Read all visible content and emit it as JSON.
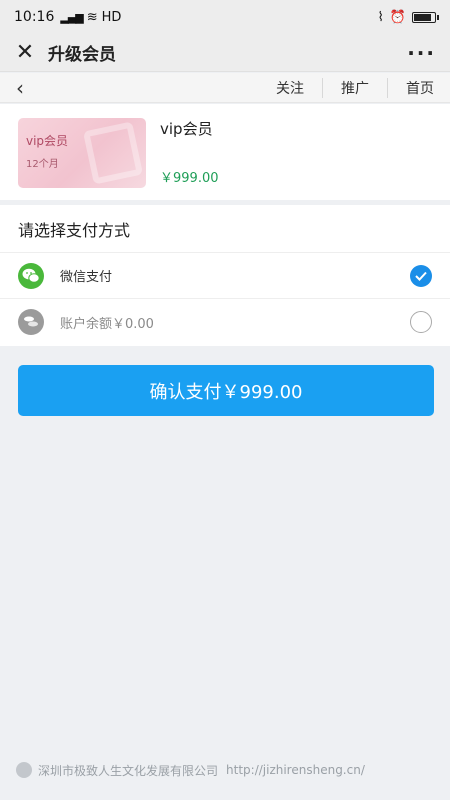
{
  "status_bar": {
    "time": "10:16",
    "signal": "46",
    "network": "HD",
    "battery_level": 0.9
  },
  "title_bar": {
    "close_icon": "close-icon",
    "title": "升级会员",
    "more": "···"
  },
  "nav": {
    "back": "‹",
    "links": [
      "关注",
      "推广",
      "首页"
    ]
  },
  "product": {
    "card_title": "vip会员",
    "card_sub": "12个月",
    "name": "vip会员",
    "price": "￥999.00"
  },
  "payment": {
    "header": "请选择支付方式",
    "options": [
      {
        "label": "微信支付",
        "selected": true,
        "icon": "wechat-icon"
      },
      {
        "label": "账户余额￥0.00",
        "selected": false,
        "icon": "wallet-icon"
      }
    ]
  },
  "confirm": {
    "label": "确认支付￥999.00"
  },
  "footer": {
    "company": "深圳市极致人生文化发展有限公司",
    "url": "http://jizhirensheng.cn/"
  },
  "colors": {
    "accent": "#1aa0f2",
    "price": "#1f9e57",
    "wechat": "#4ab83b",
    "checked": "#1a8ee8"
  }
}
